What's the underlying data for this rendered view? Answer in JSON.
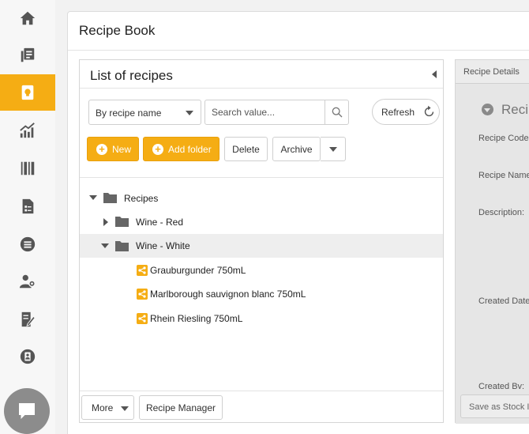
{
  "sidebar": {
    "items": [
      {
        "icon": "home-icon"
      },
      {
        "icon": "documents-icon"
      },
      {
        "icon": "recipe-book-icon",
        "active": true
      },
      {
        "icon": "analytics-icon"
      },
      {
        "icon": "barcode-icon"
      },
      {
        "icon": "report-icon"
      },
      {
        "icon": "list-icon"
      },
      {
        "icon": "user-settings-icon"
      },
      {
        "icon": "edit-document-icon"
      },
      {
        "icon": "contact-card-icon"
      }
    ],
    "chat_icon": "chat-bubble-icon",
    "accent_color": "#f5ad14"
  },
  "page": {
    "title": "Recipe Book"
  },
  "list_panel": {
    "title": "List of recipes",
    "filter_select": {
      "value": "By recipe name"
    },
    "search": {
      "placeholder": "Search value..."
    },
    "refresh_label": "Refresh",
    "actions": {
      "new_label": "New",
      "add_folder_label": "Add folder",
      "delete_label": "Delete",
      "archive_label": "Archive"
    },
    "tree": {
      "root": "Recipes",
      "folders": [
        "Wine - Red",
        "Wine - White"
      ],
      "recipes": [
        "Grauburgunder 750mL",
        "Marlborough sauvignon blanc 750mL",
        "Rhein Riesling 750mL"
      ]
    },
    "footer": {
      "more_label": "More",
      "recipe_manager_label": "Recipe Manager"
    }
  },
  "details_panel": {
    "tab_label": "Recipe Details",
    "heading": "Reci",
    "fields": {
      "recipe_code": "Recipe Code",
      "recipe_name": "Recipe Name",
      "description": "Description:",
      "created_date": "Created Date",
      "created_by": "Created By:"
    },
    "save_as_stock_label": "Save as Stock I"
  }
}
